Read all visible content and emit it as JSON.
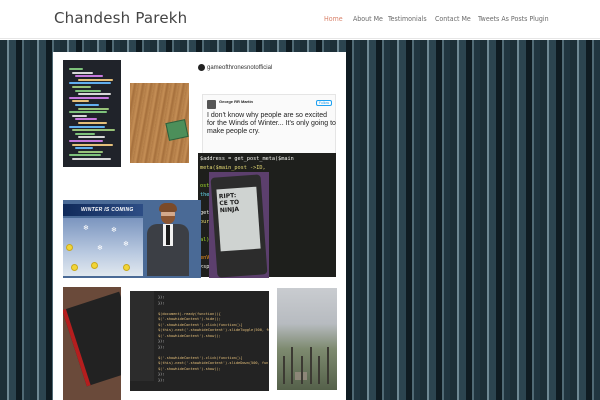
{
  "header": {
    "site_title": "Chandesh Parekh",
    "nav": [
      {
        "label": "Home",
        "active": true
      },
      {
        "label": "About Me",
        "active": false
      },
      {
        "label": "Testimonials",
        "active": false
      },
      {
        "label": "Contact Me",
        "active": false
      },
      {
        "label": "Tweets As Posts Plugin",
        "active": false
      }
    ]
  },
  "colors": {
    "nav_active": "#d9826a",
    "nav_default": "#6a6a6a",
    "stripe_dark": "#1c2f37",
    "stripe_light": "#6e8893"
  },
  "gallery": {
    "instagram_post": {
      "account": "gameofthronesnotofficial",
      "tweet": {
        "author": "George RR Martin",
        "follow_label": "Follow",
        "text": "I don't know why people are so excited for the Winds of Winter... It's only going to make people cry."
      }
    },
    "news_graphic": {
      "banner": "WINTER IS COMING"
    },
    "kindle_screen": {
      "text_line1": "RIPT:",
      "text_line2": "CE TO",
      "text_line3": "NINJA"
    },
    "php_code": [
      "$address = get_post_meta($main",
      "meta($main_post ->ID,",
      "",
      "ost->ID, 'ct_Standfi",
      "the_author_meta(",
      "",
      "get_the_time('U'), c",
      "our', 'mins', 'min",
      "",
      "al) (",
      "",
      "enVal) !== FALSE) {",
      "<span style=\"font-s"
    ],
    "jquery_code": [
      "});",
      "});",
      "",
      "$(document).ready(function(){",
      "  $('.showhideContent').hide();",
      "  $('.showhideContent').click(function(){",
      "    $(this).next('.showhideContent').slideToggle(500, fun",
      "      $('.showhideContent').show();",
      "    });",
      "  });",
      "",
      "  $('.showhideContent').click(function(){",
      "    $(this).next('.showhideContent').slideDown(500, fun",
      "      $('.showhideContent').show();",
      "    });",
      "  });"
    ]
  }
}
